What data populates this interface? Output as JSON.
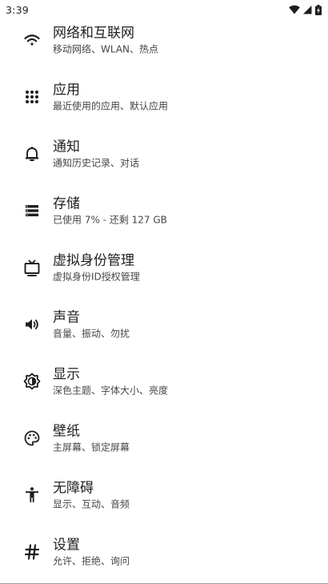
{
  "status_bar": {
    "time": "3:39",
    "icons": [
      "wifi-icon",
      "cell-signal-icon",
      "battery-icon"
    ]
  },
  "settings": {
    "items": [
      {
        "icon": "wifi-icon",
        "title": "网络和互联网",
        "subtitle": "移动网络、WLAN、热点"
      },
      {
        "icon": "apps-grid-icon",
        "title": "应用",
        "subtitle": "最近使用的应用、默认应用"
      },
      {
        "icon": "bell-icon",
        "title": "通知",
        "subtitle": "通知历史记录、对话"
      },
      {
        "icon": "storage-icon",
        "title": "存储",
        "subtitle": "已使用 7% - 还剩 127 GB"
      },
      {
        "icon": "tv-icon",
        "title": "虚拟身份管理",
        "subtitle": "虚拟身份ID授权管理"
      },
      {
        "icon": "volume-icon",
        "title": "声音",
        "subtitle": "音量、振动、勿扰"
      },
      {
        "icon": "brightness-icon",
        "title": "显示",
        "subtitle": "深色主题、字体大小、亮度"
      },
      {
        "icon": "palette-icon",
        "title": "壁纸",
        "subtitle": "主屏幕、锁定屏幕"
      },
      {
        "icon": "accessibility-icon",
        "title": "无障碍",
        "subtitle": "显示、互动、音频"
      },
      {
        "icon": "hash-icon",
        "title": "设置",
        "subtitle": "允许、拒绝、询问"
      }
    ]
  }
}
